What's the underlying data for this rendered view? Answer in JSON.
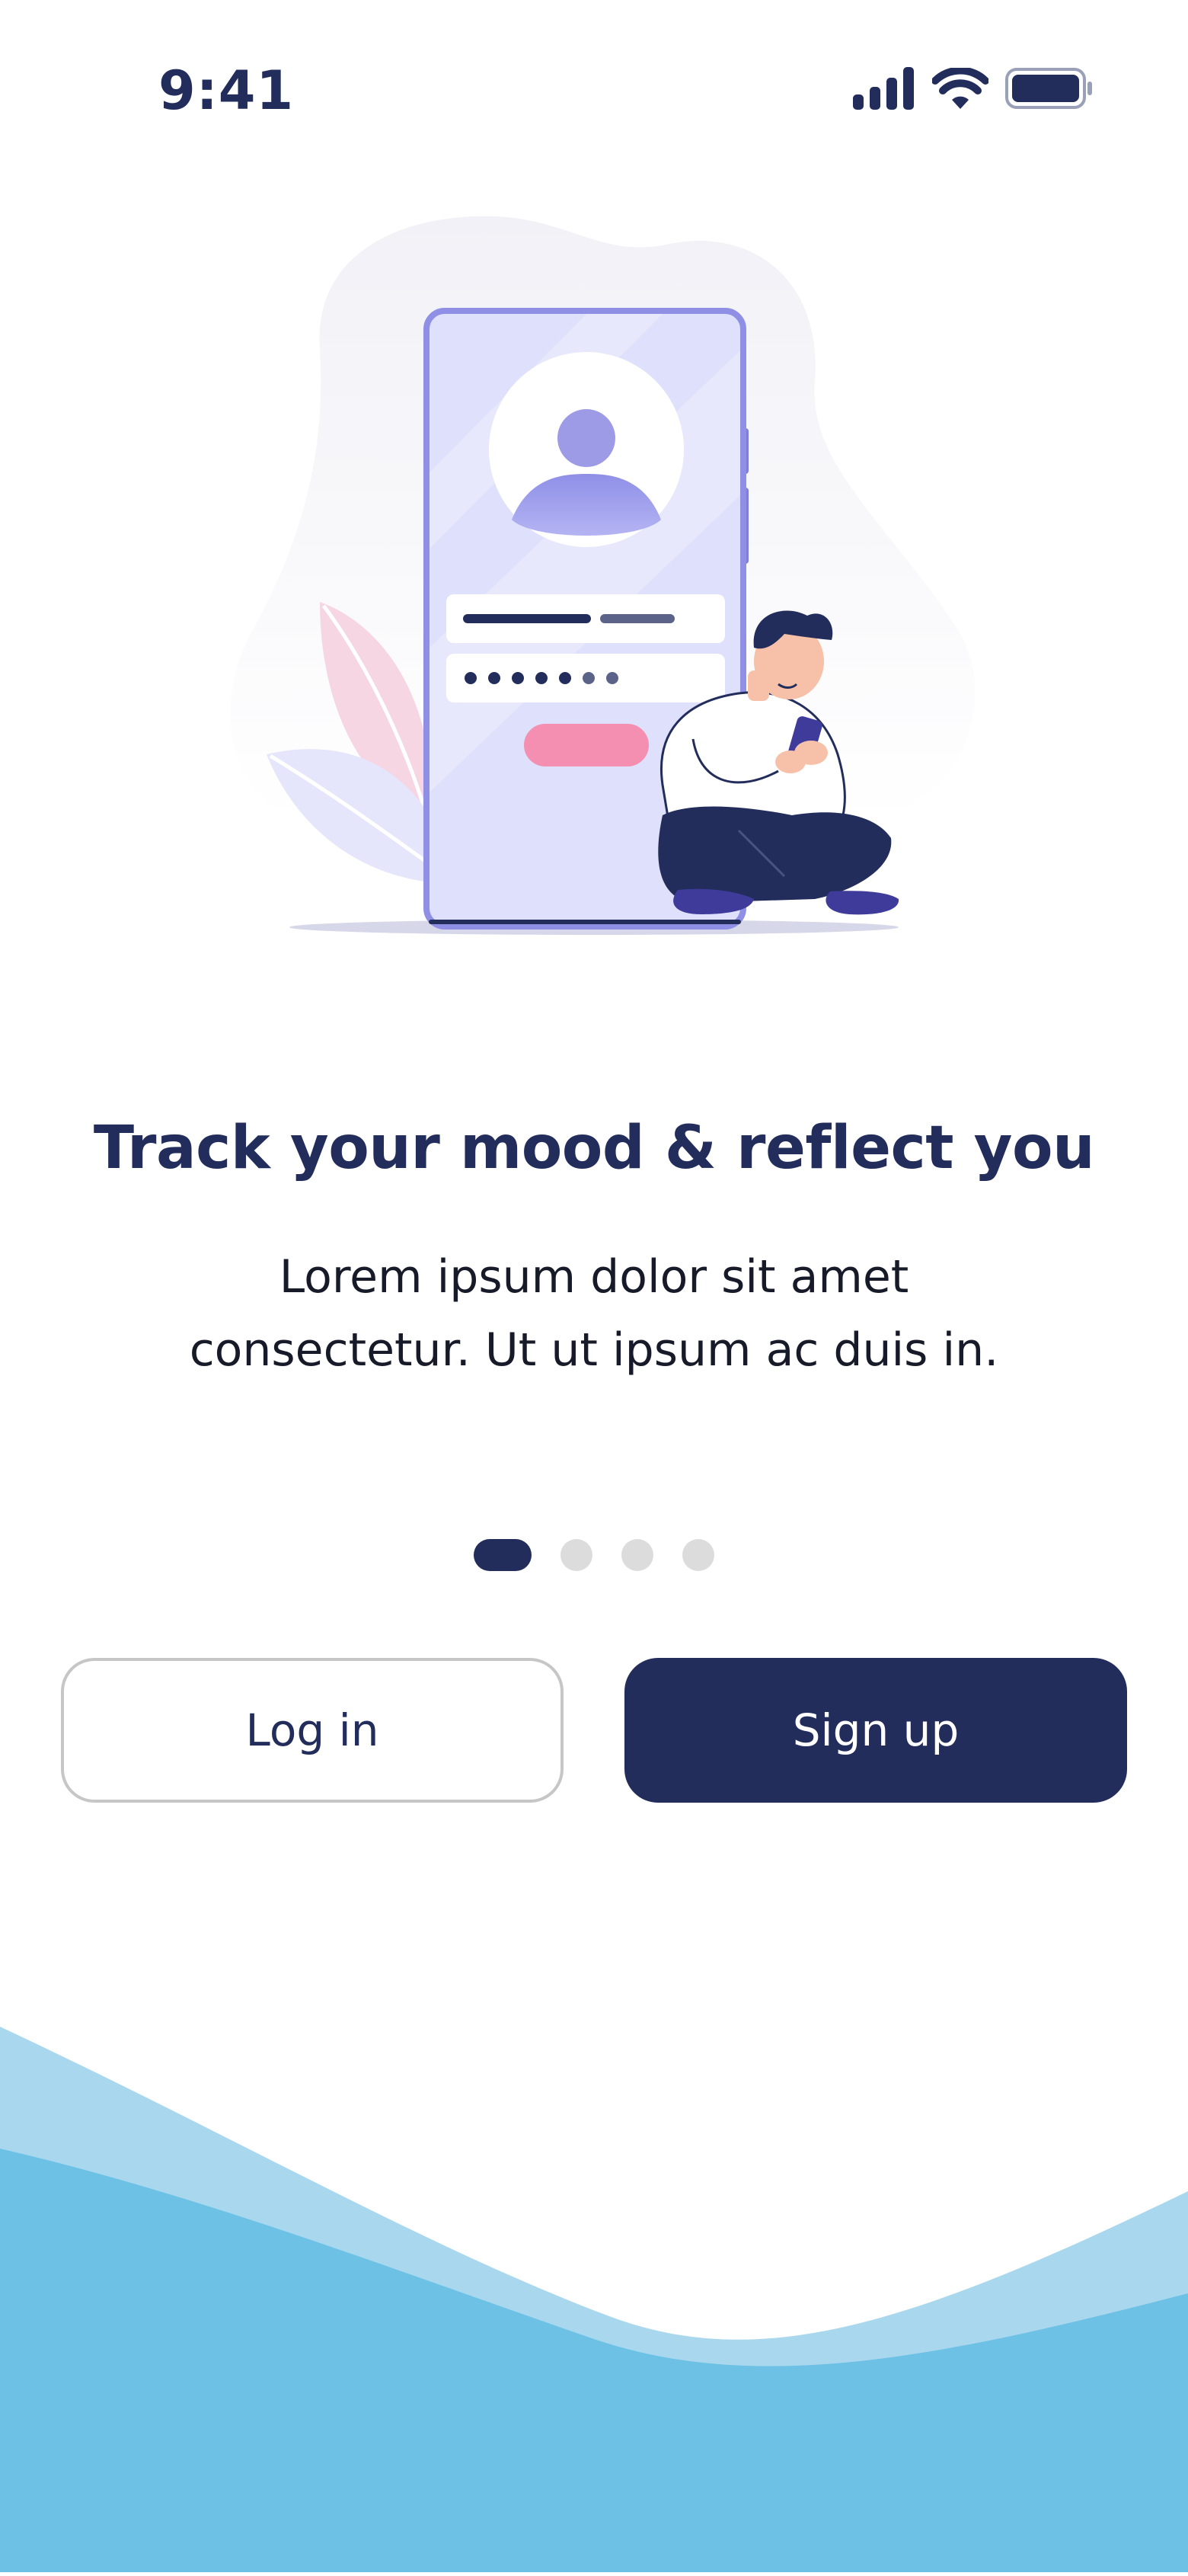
{
  "status_bar": {
    "time": "9:41",
    "icons": [
      "signal-icon",
      "wifi-icon",
      "battery-icon"
    ]
  },
  "illustration": {
    "subject": "person sitting beside large phone showing login form"
  },
  "onboarding": {
    "title": "Track your mood & reflect you",
    "subtitle_line1": "Lorem ipsum dolor sit amet",
    "subtitle_line2": "consectetur. Ut ut ipsum ac duis in.",
    "pagination": {
      "total": 4,
      "current": 1
    }
  },
  "actions": {
    "login_label": "Log in",
    "signup_label": "Sign up"
  },
  "colors": {
    "primary": "#222d5b",
    "wave_light": "#a9d8ee",
    "wave_dark": "#6cc1e5",
    "accent_pink": "#f48fb1",
    "illustration_purple": "#9b9bf0"
  }
}
